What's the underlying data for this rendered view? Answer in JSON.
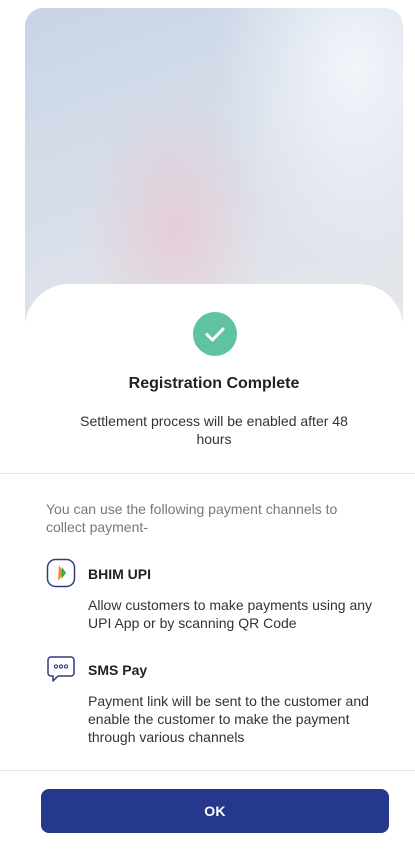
{
  "dialog": {
    "title": "Registration Complete",
    "subtitle": "Settlement process will be enabled after 48 hours",
    "intro": "You can use the following payment channels to collect payment-"
  },
  "channels": [
    {
      "icon": "bhim-upi-icon",
      "name": "BHIM UPI",
      "description": "Allow customers to make payments using any UPI App or by scanning QR Code"
    },
    {
      "icon": "sms-chat-icon",
      "name": "SMS Pay",
      "description": "Payment link will be sent to the customer and enable the customer to make the payment through various channels"
    }
  ],
  "actions": {
    "ok_label": "OK"
  },
  "colors": {
    "success": "#5fc3a0",
    "primary_button": "#25388c"
  }
}
